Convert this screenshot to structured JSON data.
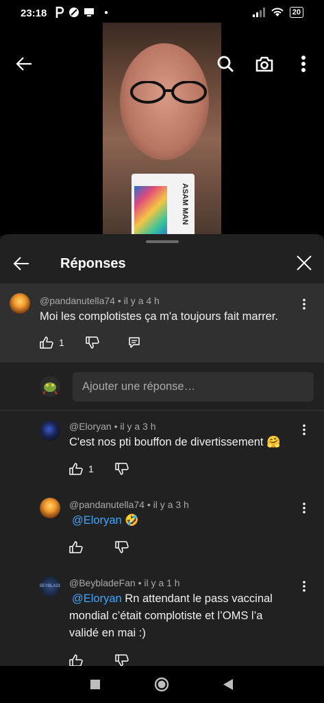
{
  "status_bar": {
    "time": "23:18",
    "battery": "20"
  },
  "video": {
    "mug_text": "ASAM MAN"
  },
  "sheet": {
    "title": "Réponses"
  },
  "parent_comment": {
    "author": "@pandanutella74",
    "age": "il y a 4 h",
    "text": "Moi les complotistes ça m'a toujours fait marrer.",
    "likes": "1"
  },
  "reply_box": {
    "placeholder": "Ajouter une réponse…"
  },
  "replies": [
    {
      "author": "@Eloryan",
      "age": "il y a 3 h",
      "text": "C'est nos pti bouffon de divertissement 🤗",
      "likes": "1"
    },
    {
      "author": "@pandanutella74",
      "age": "il y a 3 h",
      "mention": "@Eloryan",
      "text": "🤣",
      "likes": ""
    },
    {
      "author": "@BeybladeFan",
      "age": "il y a 1 h",
      "mention": "@Eloryan",
      "text_line1": "Rn attendant le  pass vaccinal",
      "text_line2": "mondial c’était complotiste et l’OMS l’a",
      "text_line3": "validé en mai :)",
      "avatar_text": "BEYBLADE FAN"
    }
  ],
  "colors": {
    "mention": "#3ea6ff",
    "sheet_bg": "#212121",
    "highlight_bg": "#303030"
  }
}
